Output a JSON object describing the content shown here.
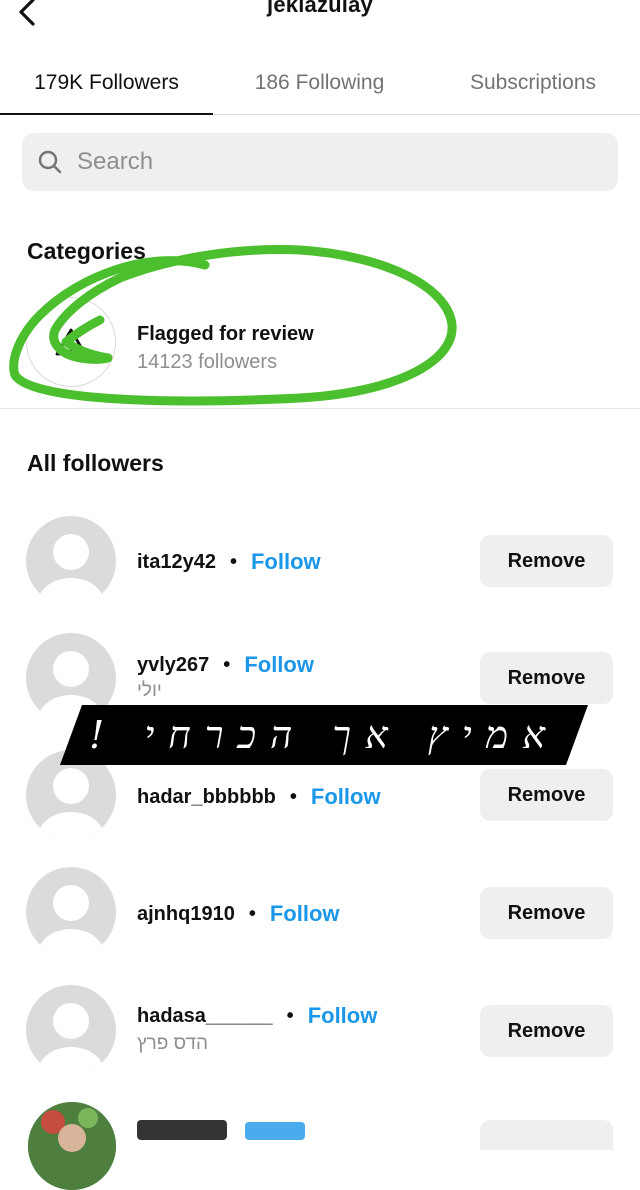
{
  "header": {
    "title": "jekiazulay"
  },
  "tabs": [
    {
      "label": "179K Followers"
    },
    {
      "label": "186 Following"
    },
    {
      "label": "Subscriptions"
    }
  ],
  "search": {
    "placeholder": "Search"
  },
  "categories": {
    "title": "Categories",
    "items": [
      {
        "name": "Flagged for review",
        "count": "14123 followers"
      }
    ]
  },
  "all_followers": {
    "title": "All followers",
    "follow_label": "Follow",
    "remove_label": "Remove",
    "dot": "•",
    "items": [
      {
        "username": "ita12y42",
        "fullname": ""
      },
      {
        "username": "yvly267",
        "fullname": "יולי"
      },
      {
        "username": "hadar_bbbbbb",
        "fullname": ""
      },
      {
        "username": "ajnhq1910",
        "fullname": ""
      },
      {
        "username": "hadasa______",
        "fullname": "הדס פרץ"
      }
    ]
  },
  "overlay": {
    "banner_text": "אמיץ אך הכרחי !"
  },
  "colors": {
    "accent": "#1a97e8",
    "annotation_green": "#4cbf2f",
    "banner": "#000000"
  }
}
